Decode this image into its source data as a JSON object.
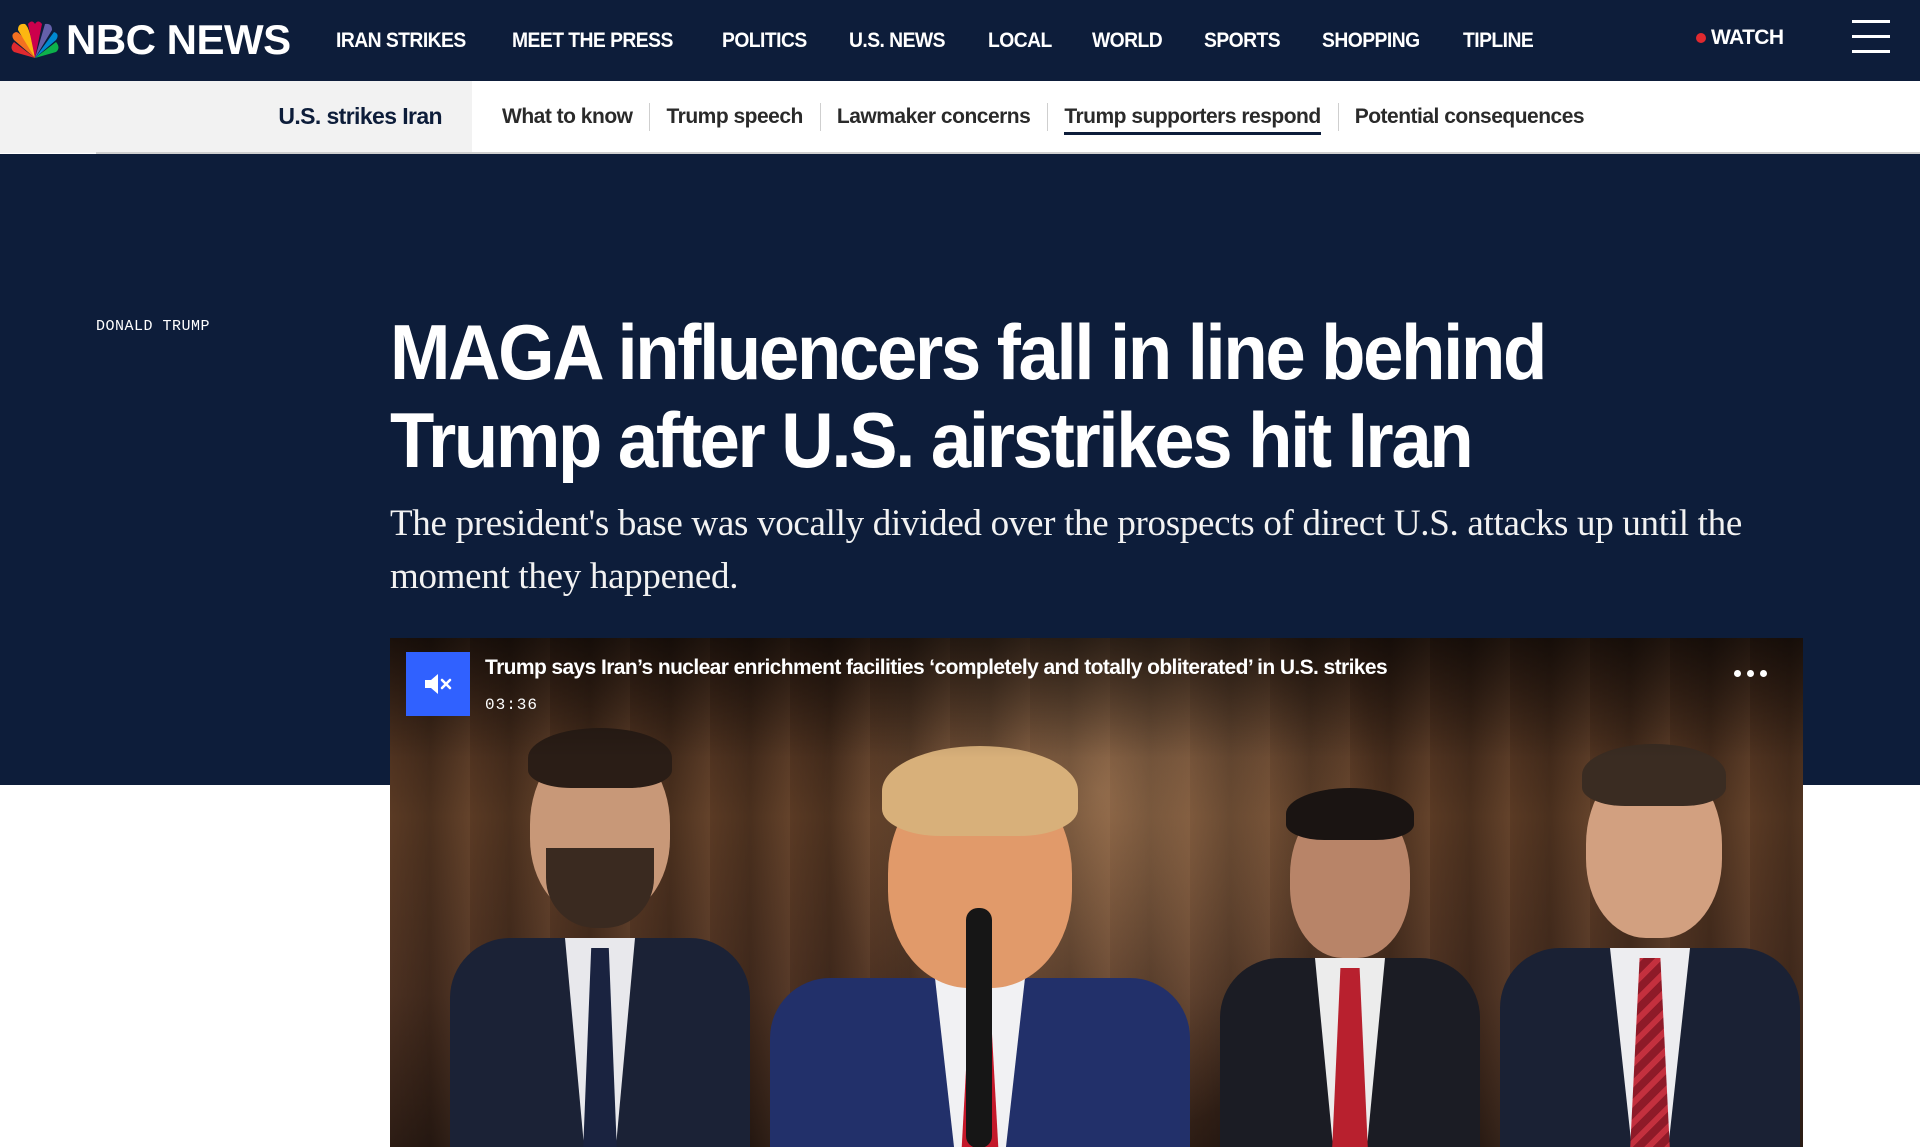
{
  "header": {
    "logo_text": "NBC NEWS",
    "nav": [
      {
        "label": "IRAN STRIKES"
      },
      {
        "label": "MEET THE PRESS"
      },
      {
        "label": "POLITICS"
      },
      {
        "label": "U.S. NEWS"
      },
      {
        "label": "LOCAL"
      },
      {
        "label": "WORLD"
      },
      {
        "label": "SPORTS"
      },
      {
        "label": "SHOPPING"
      },
      {
        "label": "TIPLINE"
      }
    ],
    "watch_label": "WATCH",
    "menu_icon": "hamburger-menu-icon"
  },
  "topic_nav": {
    "topic": "U.S. strikes Iran",
    "items": [
      {
        "label": "What to know"
      },
      {
        "label": "Trump speech"
      },
      {
        "label": "Lawmaker concerns"
      },
      {
        "label": "Trump supporters respond",
        "active": true
      },
      {
        "label": "Potential consequences"
      }
    ]
  },
  "article": {
    "eyebrow": "DONALD TRUMP",
    "headline": "MAGA influencers fall in line behind Trump after U.S. airstrikes hit Iran",
    "dek": "The president's base was vocally divided over the prospects of direct U.S. attacks up until the moment they happened."
  },
  "video": {
    "title": "Trump says Iran’s nuclear enrichment facilities ‘completely and totally obliterated’ in U.S. strikes",
    "duration": "03:36",
    "mute_icon": "speaker-muted-icon",
    "more_icon": "more-options-icon"
  },
  "colors": {
    "navy": "#0d1d3a",
    "accent_blue": "#3061ff",
    "live_red": "#e0292f"
  }
}
